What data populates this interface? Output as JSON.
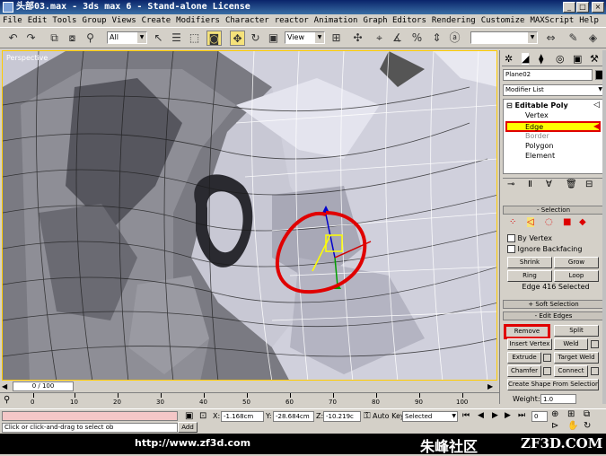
{
  "window": {
    "title": "头部03.max - 3ds max 6 - Stand-alone License",
    "min": "_",
    "max": "□",
    "close": "×"
  },
  "menu": [
    "File",
    "Edit",
    "Tools",
    "Group",
    "Views",
    "Create",
    "Modifiers",
    "Character",
    "reactor",
    "Animation",
    "Graph Editors",
    "Rendering",
    "Customize",
    "MAXScript",
    "Help"
  ],
  "toolbar": {
    "filter": "All",
    "refcoord": "View"
  },
  "viewport": {
    "label": "Perspective"
  },
  "panel": {
    "object_name": "Plane02",
    "modifier_list": "Modifier List",
    "stack": {
      "root": "Editable Poly",
      "items": [
        "Vertex",
        "Edge",
        "Border",
        "Polygon",
        "Element"
      ],
      "selected": "Edge"
    },
    "selection": {
      "header": "Selection",
      "by_vertex": "By Vertex",
      "ignore_backfacing": "Ignore Backfacing",
      "shrink": "Shrink",
      "grow": "Grow",
      "ring": "Ring",
      "loop": "Loop",
      "status": "Edge 416 Selected"
    },
    "soft_selection": "Soft Selection",
    "edit_edges": {
      "header": "Edit Edges",
      "remove": "Remove",
      "split": "Split",
      "insert_vertex": "Insert Vertex",
      "weld": "Weld",
      "extrude": "Extrude",
      "target_weld": "Target Weld",
      "chamfer": "Chamfer",
      "connect": "Connect",
      "create_shape": "Create Shape From Selection",
      "weight_label": "Weight:",
      "weight_value": "1.0"
    }
  },
  "timeline": {
    "slider": "0 / 100",
    "ticks": [
      "0",
      "10",
      "20",
      "30",
      "40",
      "50",
      "60",
      "70",
      "80",
      "90",
      "100"
    ]
  },
  "status": {
    "prompt": "Click or click-and-drag to select ob",
    "add_time": "Add",
    "x_label": "X:",
    "x_value": "-1.168cm",
    "y_label": "Y:",
    "y_value": "-28.684cm",
    "z_label": "Z:",
    "z_value": "-10.219c",
    "autokey": "Auto Key",
    "selected": "Selected",
    "frame": "0"
  },
  "banner": {
    "url": "http://www.zf3d.com",
    "cn": "朱峰社区",
    "site": "ZF3D.COM"
  },
  "colors": {
    "annotation": "#e00000",
    "highlight": "#ffff00"
  }
}
